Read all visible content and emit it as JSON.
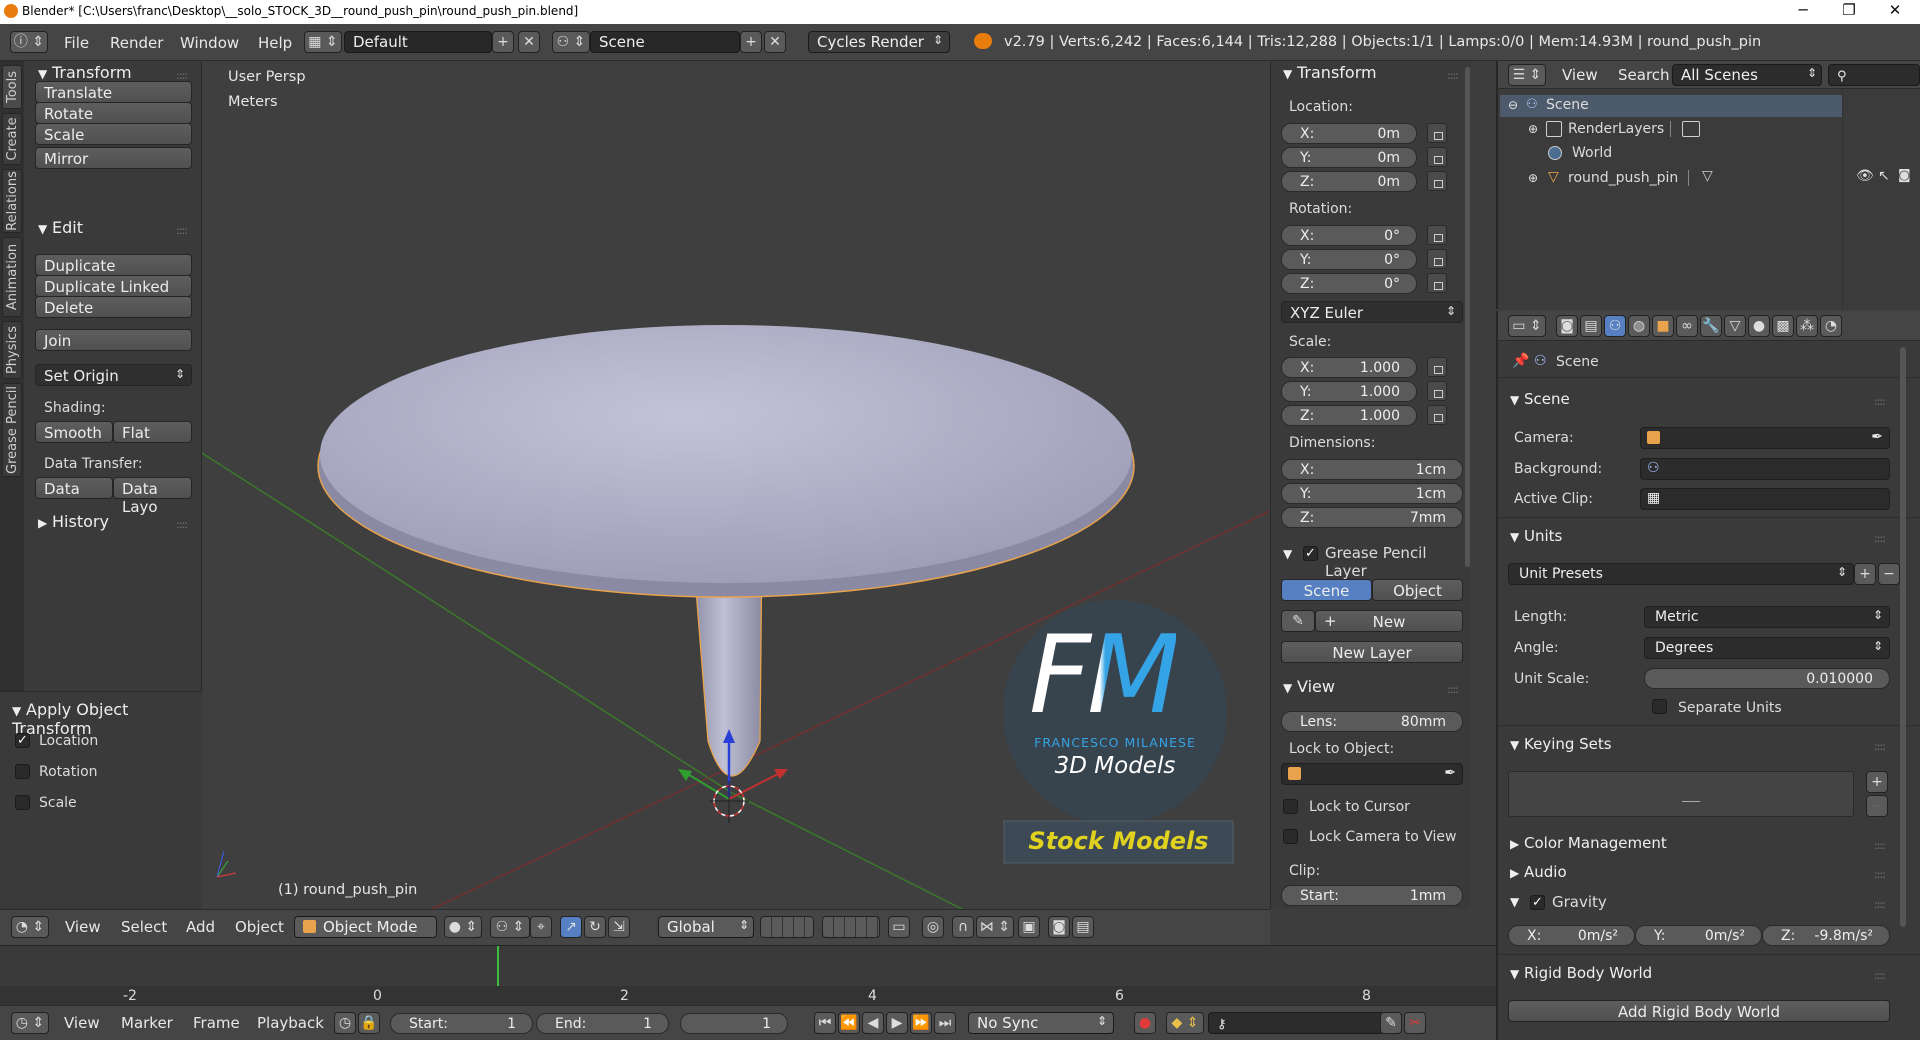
{
  "titlebar": {
    "title": "Blender* [C:\\Users\\franc\\Desktop\\__solo_STOCK_3D__round_push_pin\\round_push_pin.blend]",
    "minimize": "─",
    "maximize": "❐",
    "close": "✕"
  },
  "infobar": {
    "menus": [
      "File",
      "Render",
      "Window",
      "Help"
    ],
    "screen_layout": "Default",
    "scene": "Scene",
    "engine": "Cycles Render",
    "stats": "v2.79 | Verts:6,242 | Faces:6,144 | Tris:12,288 | Objects:1/1 | Lamps:0/0 | Mem:14.93M | round_push_pin"
  },
  "tabs": [
    "Tools",
    "Create",
    "Relations",
    "Animation",
    "Physics",
    "Grease Pencil"
  ],
  "toolshelf": {
    "transform_title": "Transform",
    "translate": "Translate",
    "rotate": "Rotate",
    "scale": "Scale",
    "mirror": "Mirror",
    "edit_title": "Edit",
    "duplicate": "Duplicate",
    "duplicate_linked": "Duplicate Linked",
    "delete": "Delete",
    "join": "Join",
    "set_origin": "Set Origin",
    "shading_label": "Shading:",
    "smooth": "Smooth",
    "flat": "Flat",
    "data_transfer_label": "Data Transfer:",
    "data": "Data",
    "data_layout": "Data Layo",
    "history_title": "History",
    "operator_title": "Apply Object Transform",
    "op_location": "Location",
    "op_rotation": "Rotation",
    "op_scale": "Scale",
    "op_location_checked": true,
    "op_rotation_checked": false,
    "op_scale_checked": false
  },
  "viewport": {
    "view_name": "User Persp",
    "units": "Meters",
    "object_label": "(1) round_push_pin",
    "watermark": {
      "monogram": "FM",
      "name": "FRANCESCO MILANESE",
      "sub": "3D Models",
      "banner": "Stock Models"
    }
  },
  "vpheader": {
    "menus": [
      "View",
      "Select",
      "Add",
      "Object"
    ],
    "mode": "Object Mode",
    "orientation": "Global"
  },
  "npanel": {
    "transform_title": "Transform",
    "location_label": "Location:",
    "location": [
      {
        "k": "X:",
        "v": "0m"
      },
      {
        "k": "Y:",
        "v": "0m"
      },
      {
        "k": "Z:",
        "v": "0m"
      }
    ],
    "rotation_label": "Rotation:",
    "rotation": [
      {
        "k": "X:",
        "v": "0°"
      },
      {
        "k": "Y:",
        "v": "0°"
      },
      {
        "k": "Z:",
        "v": "0°"
      }
    ],
    "rotation_mode": "XYZ Euler",
    "scale_label": "Scale:",
    "scale": [
      {
        "k": "X:",
        "v": "1.000"
      },
      {
        "k": "Y:",
        "v": "1.000"
      },
      {
        "k": "Z:",
        "v": "1.000"
      }
    ],
    "dimensions_label": "Dimensions:",
    "dimensions": [
      {
        "k": "X:",
        "v": "1cm"
      },
      {
        "k": "Y:",
        "v": "1cm"
      },
      {
        "k": "Z:",
        "v": "7mm"
      }
    ],
    "gp_title": "Grease Pencil Layer",
    "gp_scene": "Scene",
    "gp_object": "Object",
    "gp_new": "New",
    "gp_new_layer": "New Layer",
    "view_title": "View",
    "lens_label": "Lens:",
    "lens_value": "80mm",
    "lock_object_label": "Lock to Object:",
    "lock_cursor": "Lock to Cursor",
    "lock_camera": "Lock Camera to View",
    "clip_label": "Clip:",
    "clip_start_label": "Start:",
    "clip_start_value": "1mm"
  },
  "outliner": {
    "menus": [
      "View",
      "Search"
    ],
    "filter": "All Scenes",
    "items": [
      "Scene",
      "RenderLayers",
      "World",
      "round_push_pin"
    ]
  },
  "props": {
    "context": "Scene",
    "scene_title": "Scene",
    "camera_label": "Camera:",
    "background_label": "Background:",
    "active_clip_label": "Active Clip:",
    "units_title": "Units",
    "unit_presets": "Unit Presets",
    "length_label": "Length:",
    "length_value": "Metric",
    "angle_label": "Angle:",
    "angle_value": "Degrees",
    "unit_scale_label": "Unit Scale:",
    "unit_scale_value": "0.010000",
    "separate_units": "Separate Units",
    "keying_title": "Keying Sets",
    "color_mgmt": "Color Management",
    "audio": "Audio",
    "gravity": "Gravity",
    "gravity_x": "X:",
    "gravity_x_val": "0m/s²",
    "gravity_y": "Y:",
    "gravity_y_val": "0m/s²",
    "gravity_z": "Z:",
    "gravity_z_val": "-9.8m/s²",
    "rigid_title": "Rigid Body World",
    "add_rigid": "Add Rigid Body World"
  },
  "timeline": {
    "ruler": [
      "-2",
      "0",
      "2",
      "4",
      "6",
      "8"
    ],
    "current_frame": 1,
    "menus": [
      "View",
      "Marker",
      "Frame",
      "Playback"
    ],
    "start_label": "Start:",
    "start_value": "1",
    "end_label": "End:",
    "end_value": "1",
    "frame_value": "1",
    "sync": "No Sync"
  },
  "colors": {
    "accent_blue": "#5680c2",
    "selection_orange": "#e8a34c",
    "pin_body": "#b2b2cc",
    "watermark_blue": "#35a4e6",
    "banner_yellow": "#e0d21f"
  }
}
